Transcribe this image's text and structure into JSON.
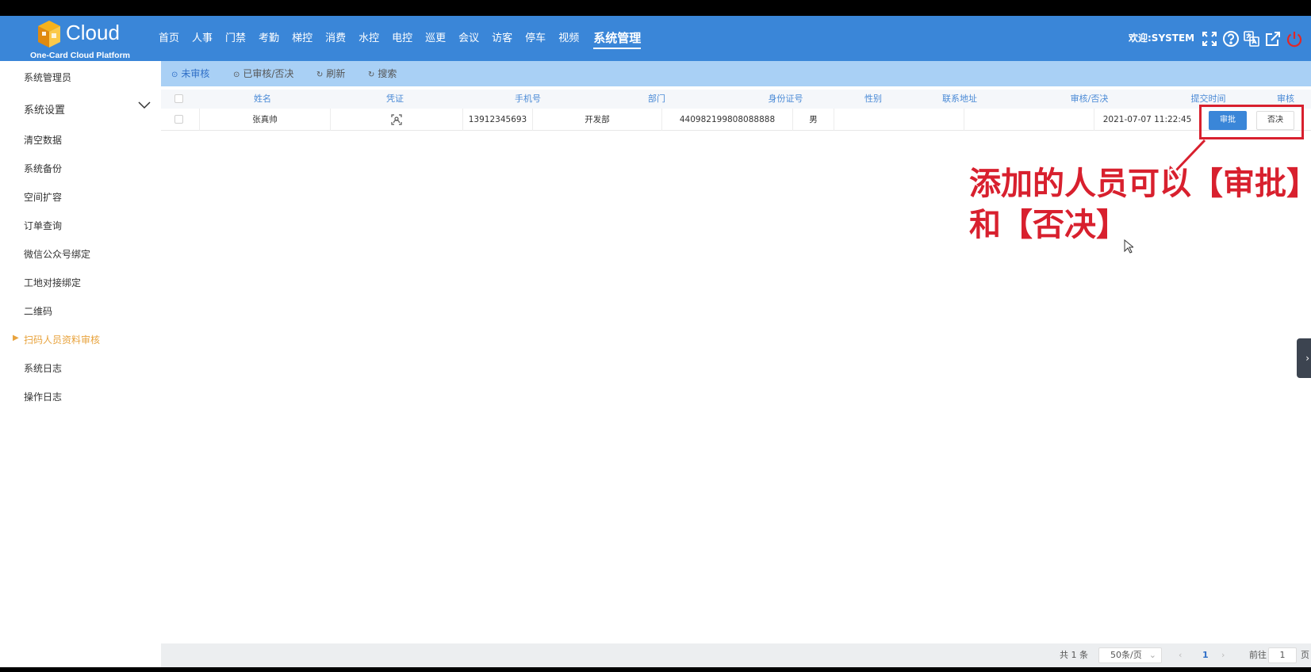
{
  "app": {
    "logo_word": "Cloud",
    "logo_subtitle": "One-Card Cloud Platform"
  },
  "nav": {
    "items": [
      "首页",
      "人事",
      "门禁",
      "考勤",
      "梯控",
      "消费",
      "水控",
      "电控",
      "巡更",
      "会议",
      "访客",
      "停车",
      "视频"
    ],
    "active": "系统管理"
  },
  "header": {
    "welcome": "欢迎:SYSTEM",
    "icons": [
      "fullscreen-icon",
      "help-icon",
      "translate-icon",
      "external-link-icon",
      "power-icon"
    ]
  },
  "sidebar": {
    "items": [
      {
        "label": "系统管理员"
      },
      {
        "label": "系统设置"
      },
      {
        "label": "清空数据"
      },
      {
        "label": "系统备份"
      },
      {
        "label": "空间扩容"
      },
      {
        "label": "订单查询"
      },
      {
        "label": "微信公众号绑定"
      },
      {
        "label": "工地对接绑定"
      },
      {
        "label": "二维码"
      },
      {
        "label": "扫码人员资料审核"
      },
      {
        "label": "系统日志"
      },
      {
        "label": "操作日志"
      }
    ],
    "active_index": 9
  },
  "toolbar": {
    "unreviewed": "未审核",
    "reviewed": "已审核/否决",
    "refresh": "刷新",
    "search": "搜索"
  },
  "table": {
    "columns": [
      "姓名",
      "凭证",
      "手机号",
      "部门",
      "身份证号",
      "性别",
      "联系地址",
      "审核/否决",
      "提交时间",
      "审核"
    ],
    "rows": [
      {
        "name": "张真帅",
        "phone": "13912345693",
        "department": "开发部",
        "id_number": "440982199808088888",
        "gender": "男",
        "address": "",
        "review_status": "",
        "submitted": "2021-07-07 11:22:45",
        "approve_label": "审批",
        "reject_label": "否决"
      }
    ]
  },
  "annotation": {
    "line1": "添加的人员可以【审批】",
    "line2": "和【否决】"
  },
  "pagination": {
    "total": "共 1 条",
    "page_size": "50条/页",
    "current_page": "1",
    "goto_label": "前往",
    "goto_value": "1",
    "page_suffix": "页"
  },
  "colors": {
    "header_bg": "#3a86d8",
    "toolbar_bg": "#a9d0f5",
    "active_sidebar": "#e8a33d",
    "annotation_red": "#d8202e"
  }
}
